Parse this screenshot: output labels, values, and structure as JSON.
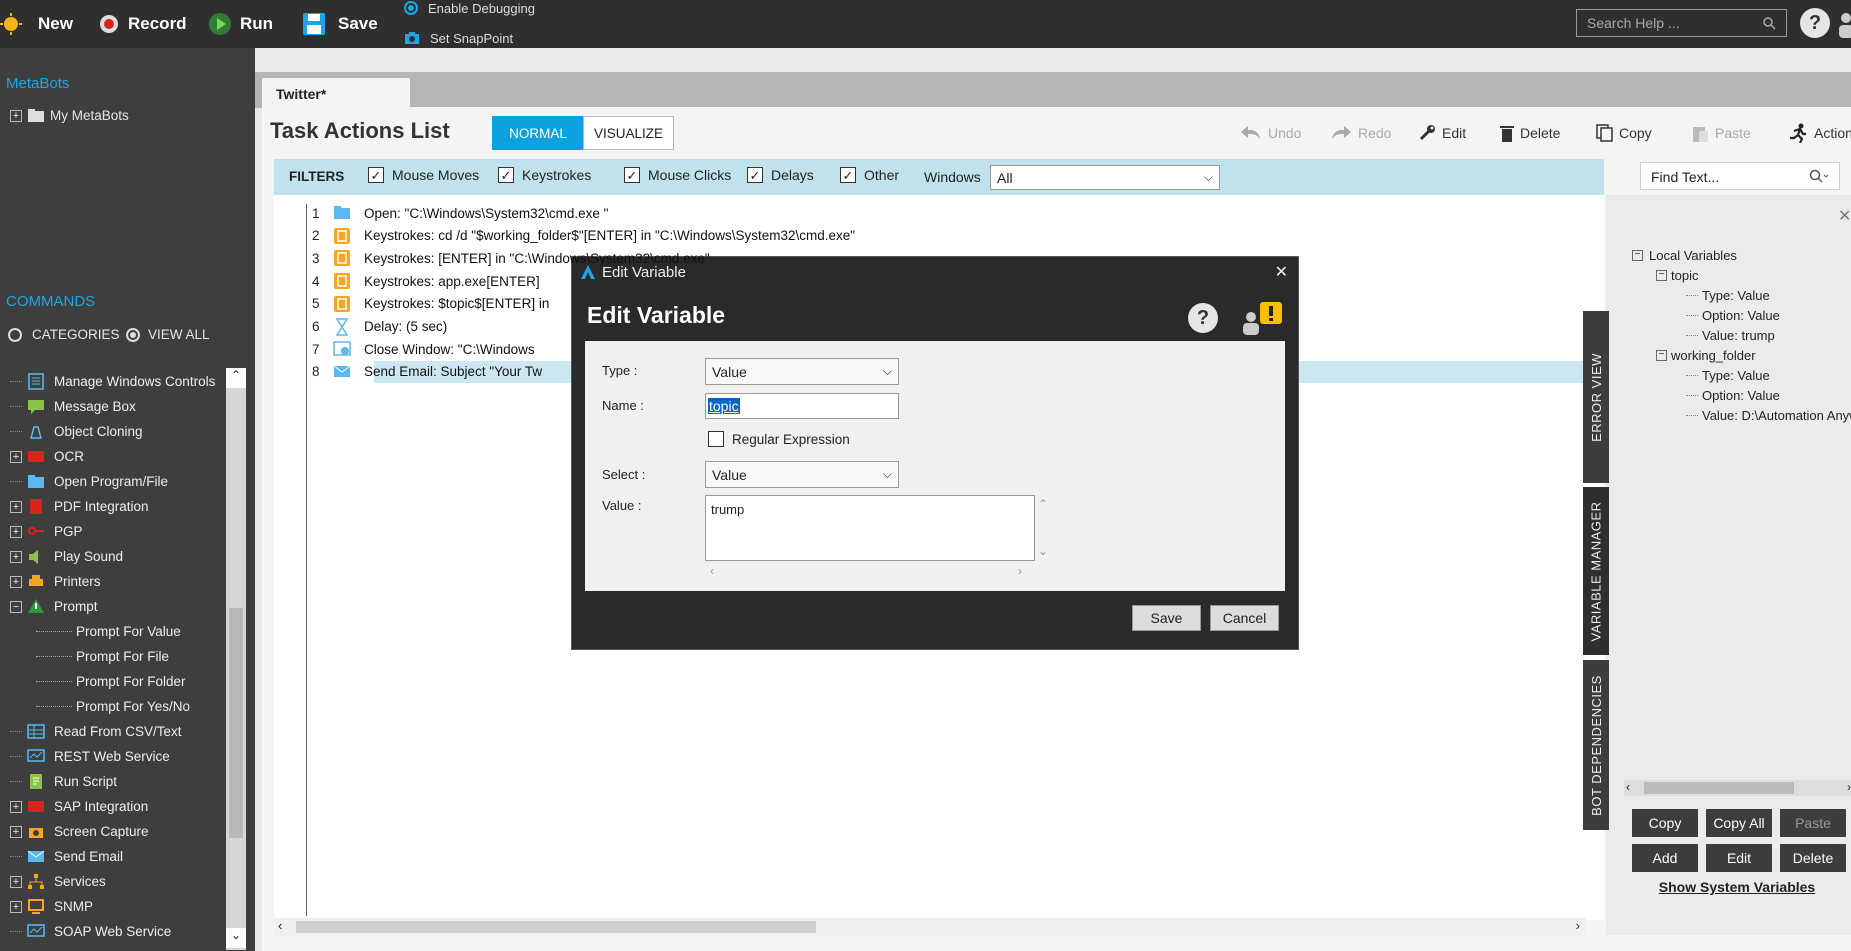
{
  "topbar": {
    "new_label": "New",
    "record_label": "Record",
    "run_label": "Run",
    "save_label": "Save",
    "enable_debugging": "Enable Debugging",
    "set_snappoint": "Set SnapPoint",
    "search_placeholder": "Search Help ...",
    "help_glyph": "?"
  },
  "left": {
    "metabots_heading": "MetaBots",
    "my_metabots": "My MetaBots",
    "commands_heading": "COMMANDS",
    "categories_label": "CATEGORIES",
    "viewall_label": "VIEW ALL",
    "commands": [
      {
        "label": "Manage Windows Controls",
        "expandable": false,
        "icon": "window-controls-icon"
      },
      {
        "label": "Message Box",
        "expandable": false,
        "icon": "message-box-icon"
      },
      {
        "label": "Object Cloning",
        "expandable": false,
        "icon": "object-cloning-icon"
      },
      {
        "label": "OCR",
        "expandable": true,
        "icon": "ocr-icon"
      },
      {
        "label": "Open Program/File",
        "expandable": false,
        "icon": "folder-icon"
      },
      {
        "label": "PDF Integration",
        "expandable": true,
        "icon": "pdf-icon"
      },
      {
        "label": "PGP",
        "expandable": true,
        "icon": "key-icon"
      },
      {
        "label": "Play Sound",
        "expandable": true,
        "icon": "speaker-icon"
      },
      {
        "label": "Printers",
        "expandable": true,
        "icon": "printer-icon"
      },
      {
        "label": "Prompt",
        "expandable": true,
        "icon": "warning-icon"
      },
      {
        "label": "Read From CSV/Text",
        "expandable": false,
        "icon": "table-icon"
      },
      {
        "label": "REST Web Service",
        "expandable": false,
        "icon": "web-service-icon"
      },
      {
        "label": "Run Script",
        "expandable": false,
        "icon": "script-icon"
      },
      {
        "label": "SAP Integration",
        "expandable": true,
        "icon": "sap-icon"
      },
      {
        "label": "Screen Capture",
        "expandable": true,
        "icon": "camera-icon"
      },
      {
        "label": "Send Email",
        "expandable": false,
        "icon": "email-icon"
      },
      {
        "label": "Services",
        "expandable": true,
        "icon": "services-icon"
      },
      {
        "label": "SNMP",
        "expandable": true,
        "icon": "snmp-icon"
      },
      {
        "label": "SOAP Web Service",
        "expandable": false,
        "icon": "web-service-icon"
      }
    ],
    "prompt_children": [
      "Prompt For Value",
      "Prompt For File",
      "Prompt For Folder",
      "Prompt For Yes/No"
    ]
  },
  "main": {
    "tab_label": "Twitter*",
    "title": "Task Actions List",
    "mode_normal": "NORMAL",
    "mode_visualize": "VISUALIZE",
    "tools": {
      "undo": "Undo",
      "redo": "Redo",
      "edit": "Edit",
      "delete": "Delete",
      "copy": "Copy",
      "paste": "Paste",
      "actions": "Actions"
    },
    "filters_label": "FILTERS",
    "filters": [
      "Mouse Moves",
      "Keystrokes",
      "Mouse Clicks",
      "Delays",
      "Other"
    ],
    "windows_label": "Windows",
    "windows_value": "All",
    "find_placeholder": "Find Text...",
    "actions": [
      {
        "num": "1",
        "text": "Open: \"C:\\Windows\\System32\\cmd.exe \"",
        "icon": "folder-icon"
      },
      {
        "num": "2",
        "text": "Keystrokes: cd /d \"$working_folder$\"[ENTER] in \"C:\\Windows\\System32\\cmd.exe\"",
        "icon": "keystrokes-icon"
      },
      {
        "num": "3",
        "text": "Keystrokes: [ENTER] in \"C:\\Windows\\System32\\cmd.exe\"",
        "icon": "keystrokes-icon"
      },
      {
        "num": "4",
        "text": "Keystrokes: app.exe[ENTER]",
        "icon": "keystrokes-icon"
      },
      {
        "num": "5",
        "text": "Keystrokes: $topic$[ENTER] in",
        "icon": "keystrokes-icon"
      },
      {
        "num": "6",
        "text": "Delay: (5 sec)",
        "icon": "hourglass-icon"
      },
      {
        "num": "7",
        "text": "Close Window: \"C:\\Windows",
        "icon": "close-window-icon"
      },
      {
        "num": "8",
        "text": "Send Email: Subject \"Your Tw",
        "icon": "email-icon"
      }
    ]
  },
  "right": {
    "vtabs": [
      "ERROR VIEW",
      "VARIABLE MANAGER",
      "BOT DEPENDENCIES"
    ],
    "tree": {
      "root": "Local Variables",
      "vars": [
        {
          "name": "topic",
          "type": "Type: Value",
          "option": "Option: Value",
          "value": "Value: trump"
        },
        {
          "name": "working_folder",
          "type": "Type: Value",
          "option": "Option: Value",
          "value": "Value: D:\\Automation Anywhere"
        }
      ]
    },
    "buttons": {
      "copy": "Copy",
      "copy_all": "Copy All",
      "paste": "Paste",
      "add": "Add",
      "edit": "Edit",
      "delete": "Delete"
    },
    "show_system": "Show System Variables"
  },
  "dialog": {
    "window_title": "Edit Variable",
    "heading": "Edit Variable",
    "type_label": "Type :",
    "type_value": "Value",
    "name_label": "Name :",
    "name_value": "topic",
    "regex_label": "Regular Expression",
    "select_label": "Select :",
    "select_value": "Value",
    "value_label": "Value :",
    "value_text": "trump",
    "save": "Save",
    "cancel": "Cancel"
  },
  "colors": {
    "accent": "#1da6e6",
    "toolbar": "#2f2f2f",
    "filterbar": "#bfe2ed",
    "selection": "#cbe8f0"
  }
}
